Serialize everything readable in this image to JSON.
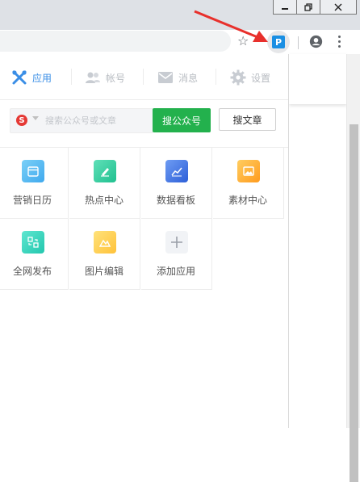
{
  "browser": {
    "window_buttons": [
      "minimize",
      "restore",
      "close"
    ],
    "extension_label": "P",
    "extension_color": "#1a8fe3"
  },
  "popup": {
    "tabs": [
      {
        "label": "应用",
        "icon": "puzzle-icon",
        "active": true
      },
      {
        "label": "帐号",
        "icon": "users-icon",
        "active": false
      },
      {
        "label": "消息",
        "icon": "mail-icon",
        "active": false
      },
      {
        "label": "设置",
        "icon": "gear-icon",
        "active": false
      }
    ],
    "search": {
      "engine_logo": "S",
      "placeholder": "搜索公众号或文章",
      "value": "",
      "btn_account": "搜公众号",
      "btn_article": "搜文章"
    },
    "apps": [
      {
        "label": "营销日历",
        "icon": "calendar-icon",
        "color": "#5cc0f2"
      },
      {
        "label": "热点中心",
        "icon": "pen-icon",
        "color": "#3dd3a8"
      },
      {
        "label": "数据看板",
        "icon": "chart-icon",
        "color": "#3f76e8"
      },
      {
        "label": "素材中心",
        "icon": "image-icon",
        "color": "#ffb23a"
      },
      {
        "label": "全网发布",
        "icon": "share-icon",
        "color": "#3dd6c0"
      },
      {
        "label": "图片编辑",
        "icon": "picture-edit-icon",
        "color": "#ffd25a"
      },
      {
        "label": "添加应用",
        "icon": "plus-icon",
        "color": "#f1f3f6"
      }
    ]
  },
  "colors": {
    "accent": "#3a8ee6",
    "green": "#23b14d",
    "arrow": "#e8302c"
  }
}
